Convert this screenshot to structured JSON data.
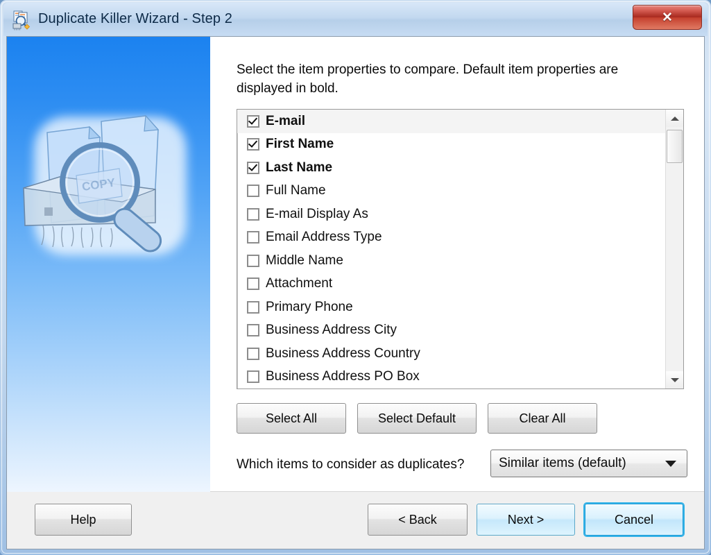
{
  "window": {
    "title": "Duplicate Killer Wizard - Step 2",
    "icon": "duplicate-killer-icon",
    "close_label": "✕"
  },
  "content": {
    "intro_text": "Select the item properties to compare. Default item properties are displayed in bold.",
    "list": {
      "items": [
        {
          "label": "E-mail",
          "checked": true,
          "bold": true,
          "highlighted": true
        },
        {
          "label": "First Name",
          "checked": true,
          "bold": true,
          "highlighted": false
        },
        {
          "label": "Last Name",
          "checked": true,
          "bold": true,
          "highlighted": false
        },
        {
          "label": "Full Name",
          "checked": false,
          "bold": false,
          "highlighted": false
        },
        {
          "label": "E-mail Display As",
          "checked": false,
          "bold": false,
          "highlighted": false
        },
        {
          "label": "Email Address Type",
          "checked": false,
          "bold": false,
          "highlighted": false
        },
        {
          "label": "Middle Name",
          "checked": false,
          "bold": false,
          "highlighted": false
        },
        {
          "label": "Attachment",
          "checked": false,
          "bold": false,
          "highlighted": false
        },
        {
          "label": "Primary Phone",
          "checked": false,
          "bold": false,
          "highlighted": false
        },
        {
          "label": "Business Address City",
          "checked": false,
          "bold": false,
          "highlighted": false
        },
        {
          "label": "Business Address Country",
          "checked": false,
          "bold": false,
          "highlighted": false
        },
        {
          "label": "Business Address PO Box",
          "checked": false,
          "bold": false,
          "highlighted": false
        }
      ]
    },
    "selection_buttons": {
      "select_all": "Select All",
      "select_default": "Select Default",
      "clear_all": "Clear All"
    },
    "duplicates": {
      "question": "Which items to consider as duplicates?",
      "selected": "Similar items (default)",
      "options": [
        "Similar items (default)"
      ]
    }
  },
  "footer": {
    "help": "Help",
    "back": "< Back",
    "next": "Next >",
    "cancel": "Cancel"
  },
  "colors": {
    "sidebar_top": "#1b82f0",
    "sidebar_bottom": "#eef6ff",
    "titlebar": "#b6cfe9",
    "close_red": "#a82a1f",
    "focus_blue": "#35b3e8"
  }
}
